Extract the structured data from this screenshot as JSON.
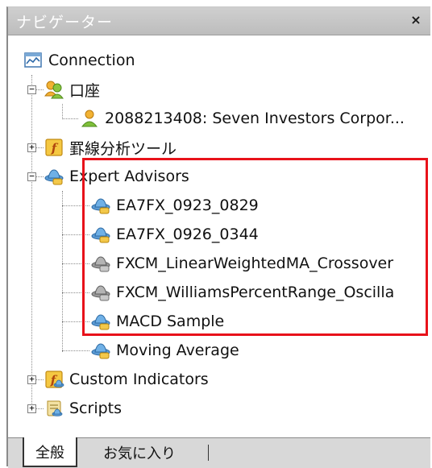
{
  "window": {
    "title": "ナビゲーター",
    "close_label": "×"
  },
  "tree": {
    "connection": "Connection",
    "account_group": "口座",
    "account_item": "2088213408: Seven Investors Corpor...",
    "drawing_tools": "罫線分析ツール",
    "expert_advisors": "Expert Advisors",
    "ea_items": [
      "EA7FX_0923_0829",
      "EA7FX_0926_0344",
      "FXCM_LinearWeightedMA_Crossover",
      "FXCM_WilliamsPercentRange_Oscilla",
      "MACD Sample",
      "Moving Average"
    ],
    "custom_indicators": "Custom Indicators",
    "scripts": "Scripts"
  },
  "tabs": {
    "general": "全般",
    "favorites": "お気に入り"
  },
  "colors": {
    "highlight_border": "#e8121a",
    "title_bg": "#c6c6c6"
  }
}
